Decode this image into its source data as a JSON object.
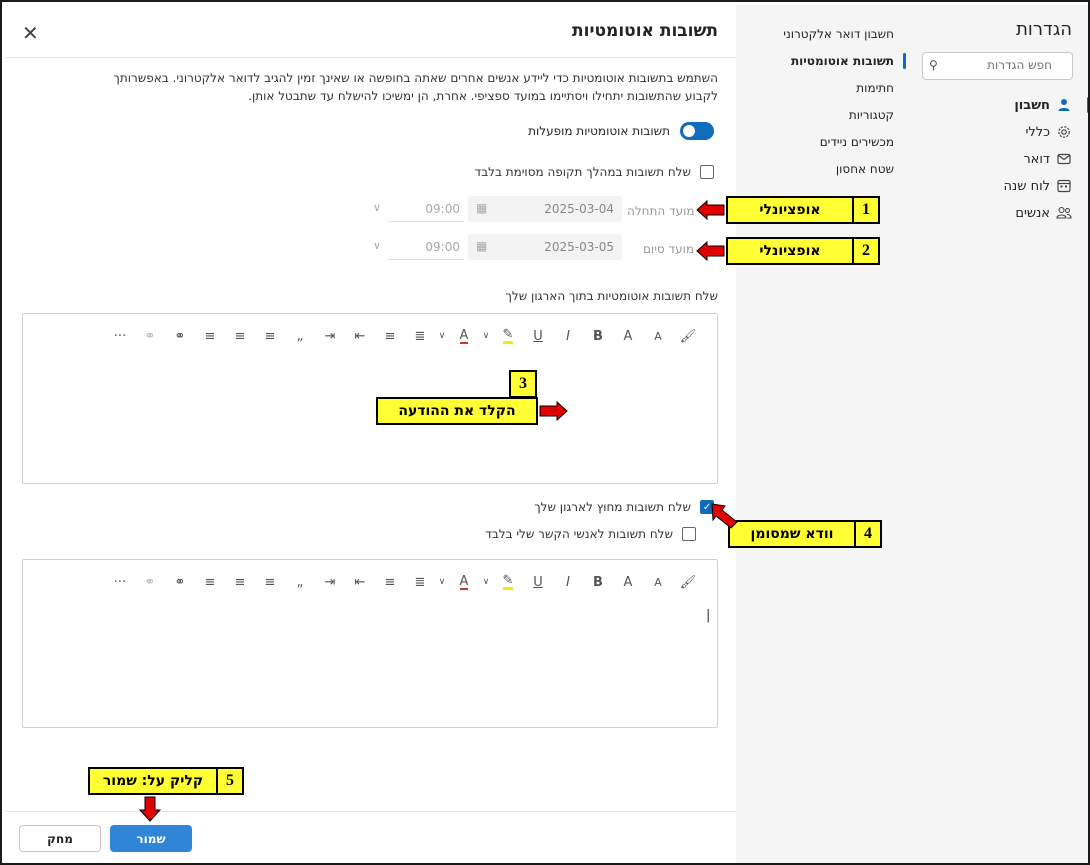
{
  "settings": {
    "title": "הגדרות",
    "search_placeholder": "חפש הגדרות",
    "categories": [
      {
        "label": "חשבון",
        "icon": "person-icon"
      },
      {
        "label": "כללי",
        "icon": "gear-icon"
      },
      {
        "label": "דואר",
        "icon": "mail-icon"
      },
      {
        "label": "לוח שנה",
        "icon": "calendar-icon"
      },
      {
        "label": "אנשים",
        "icon": "people-icon"
      }
    ]
  },
  "submenu": {
    "items": [
      {
        "label": "חשבון דואר אלקטרוני"
      },
      {
        "label": "תשובות אוטומטיות"
      },
      {
        "label": "חתימות"
      },
      {
        "label": "קטגוריות"
      },
      {
        "label": "מכשירים ניידים"
      },
      {
        "label": "שטח אחסון"
      }
    ]
  },
  "main": {
    "title": "תשובות אוטומטיות",
    "description": "השתמש בתשובות אוטומטיות כדי ליידע אנשים אחרים שאתה בחופשה או שאינך זמין להגיב לדואר אלקטרוני. באפשרותך לקבוע שהתשובות יתחילו ויסתיימו במועד ספציפי. אחרת, הן ימשיכו להישלח עד שתבטל אותן.",
    "toggle_label": "תשובות אוטומטיות מופעלות",
    "period_label": "שלח תשובות במהלך תקופה מסוימת בלבד",
    "start_label": "מועד התחלה",
    "start_date": "2025-03-04",
    "start_time": "09:00",
    "end_label": "מועד סיום",
    "end_date": "2025-03-05",
    "end_time": "09:00",
    "inside_label": "שלח תשובות אוטומטיות בתוך הארגון שלך",
    "outside_label": "שלח תשובות מחוץ לארגון שלך",
    "contacts_label": "שלח תשובות לאנשי הקשר שלי בלבד",
    "toolbar_glyphs": {
      "format_painter": "🖌",
      "font_size": "A",
      "grow": "A",
      "bold": "B",
      "italic": "I",
      "underline": "U",
      "highlight": "✎",
      "font_color": "A",
      "dropdown": "∨",
      "bullets": "≣",
      "numbering": "≡",
      "decrease_indent": "⇤",
      "increase_indent": "⇥",
      "quote": "„",
      "align_left": "≡",
      "align_center": "≡",
      "align_right": "≡",
      "link": "⚭",
      "unlink": "⚭",
      "more": "···"
    },
    "save_label": "שמור",
    "discard_label": "מחק"
  },
  "annotations": [
    {
      "num": "1",
      "text": "אופציונלי"
    },
    {
      "num": "2",
      "text": "אופציונלי"
    },
    {
      "num": "3",
      "text": "הקלד את ההודעה"
    },
    {
      "num": "4",
      "text": "וודא שמסומן"
    },
    {
      "num": "5",
      "text": "קליק על: שמור"
    }
  ],
  "colors": {
    "accent": "#0f6cbd",
    "save_button": "#2f86d6",
    "callout": "#ffff33",
    "arrow": "#e00000"
  }
}
